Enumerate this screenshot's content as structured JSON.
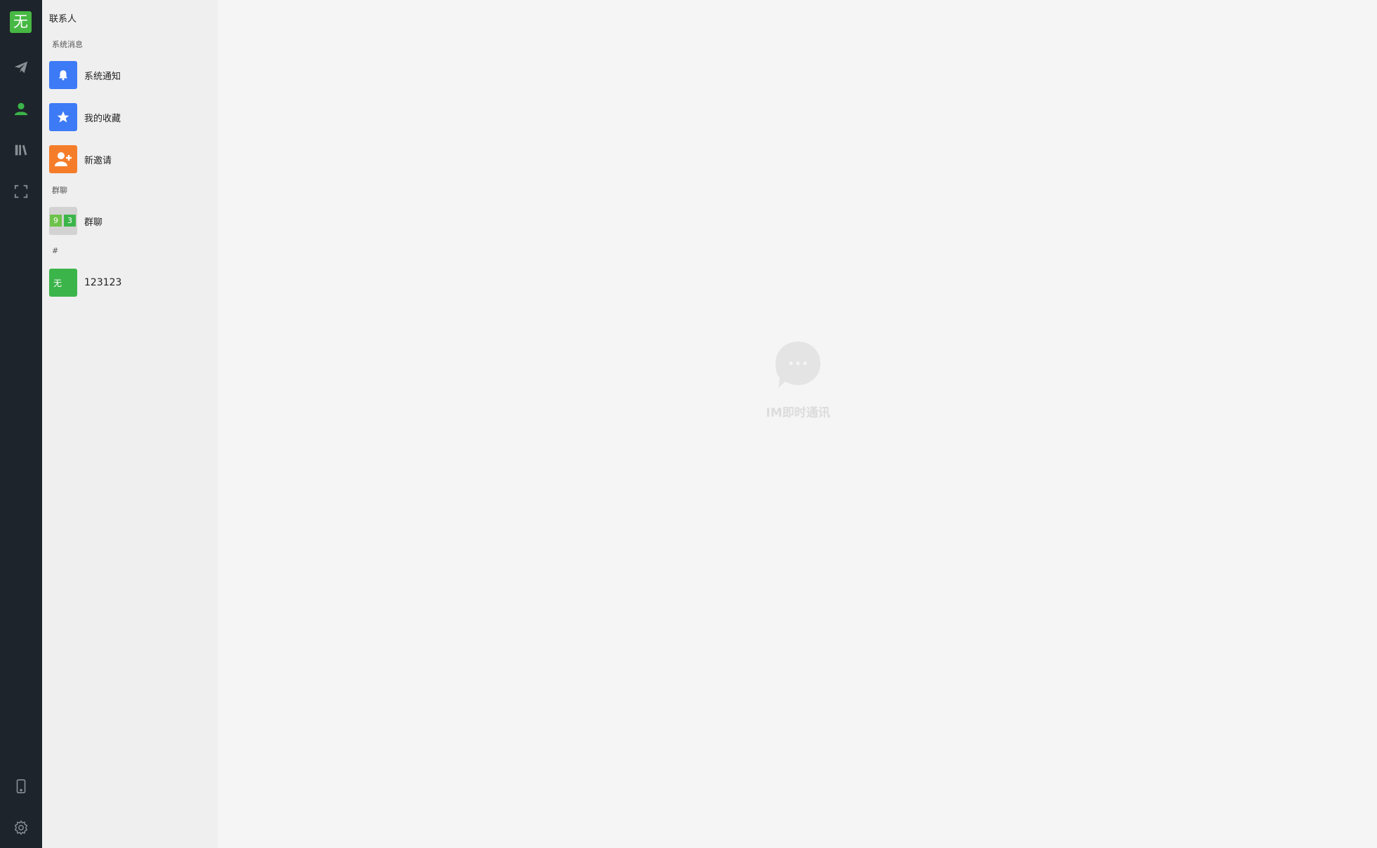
{
  "user": {
    "avatar_text": "无"
  },
  "nav": {
    "items": [
      {
        "name": "paper-plane-icon"
      },
      {
        "name": "contacts-icon"
      },
      {
        "name": "library-icon"
      },
      {
        "name": "fullscreen-icon"
      }
    ],
    "bottom": [
      {
        "name": "phone-icon"
      },
      {
        "name": "settings-icon"
      }
    ],
    "active_color": "#3bb54a"
  },
  "contacts": {
    "title": "联系人",
    "system_section": "系统消息",
    "system_items": [
      {
        "label": "系统通知",
        "icon": "bell-icon",
        "color": "#3d7af6"
      },
      {
        "label": "我的收藏",
        "icon": "star-icon",
        "color": "#3d7af6"
      },
      {
        "label": "新邀请",
        "icon": "add-user-icon",
        "color": "#f57d2a"
      }
    ],
    "group_section": "群聊",
    "groups": [
      {
        "label": "群聊",
        "avatar_cells": [
          "9",
          "3"
        ]
      }
    ],
    "hash_section": "#",
    "friends": [
      {
        "label": "123123",
        "avatar_text": "无",
        "color": "#3bb54a"
      }
    ]
  },
  "empty_state": {
    "text": "IM即时通讯"
  }
}
